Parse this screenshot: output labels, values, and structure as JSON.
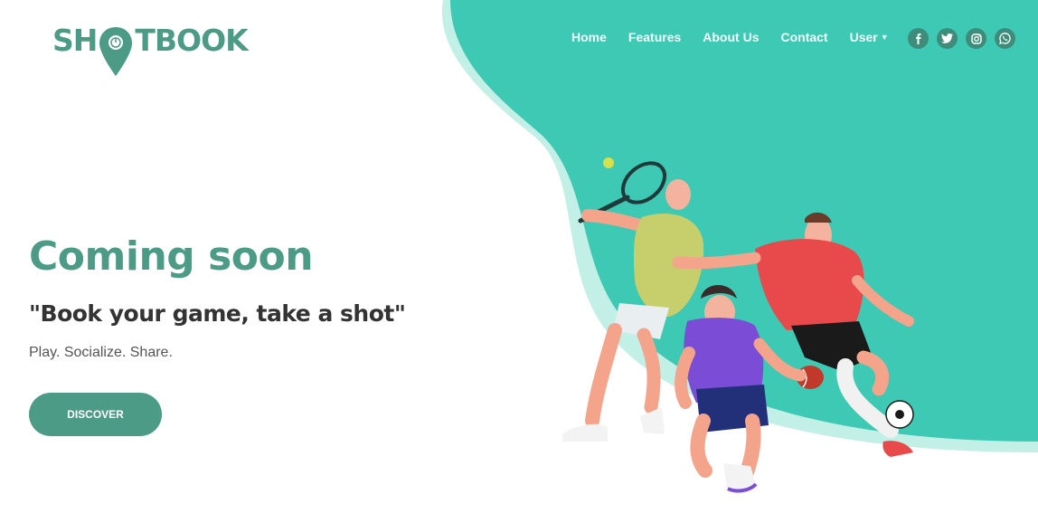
{
  "brand": {
    "logo_prefix": "SH",
    "logo_suffix": "TBOOK",
    "accent": "#4c9b86",
    "teal": "#3ec9b4"
  },
  "nav": {
    "items": [
      {
        "label": "Home"
      },
      {
        "label": "Features"
      },
      {
        "label": "About Us"
      },
      {
        "label": "Contact"
      },
      {
        "label": "User"
      }
    ],
    "social": [
      {
        "icon": "facebook-icon"
      },
      {
        "icon": "twitter-icon"
      },
      {
        "icon": "instagram-icon"
      },
      {
        "icon": "whatsapp-icon"
      }
    ]
  },
  "hero": {
    "title": "Coming soon",
    "tagline": "\"Book your game, take a shot\"",
    "subline": "Play. Socialize. Share.",
    "cta_label": "DISCOVER"
  }
}
